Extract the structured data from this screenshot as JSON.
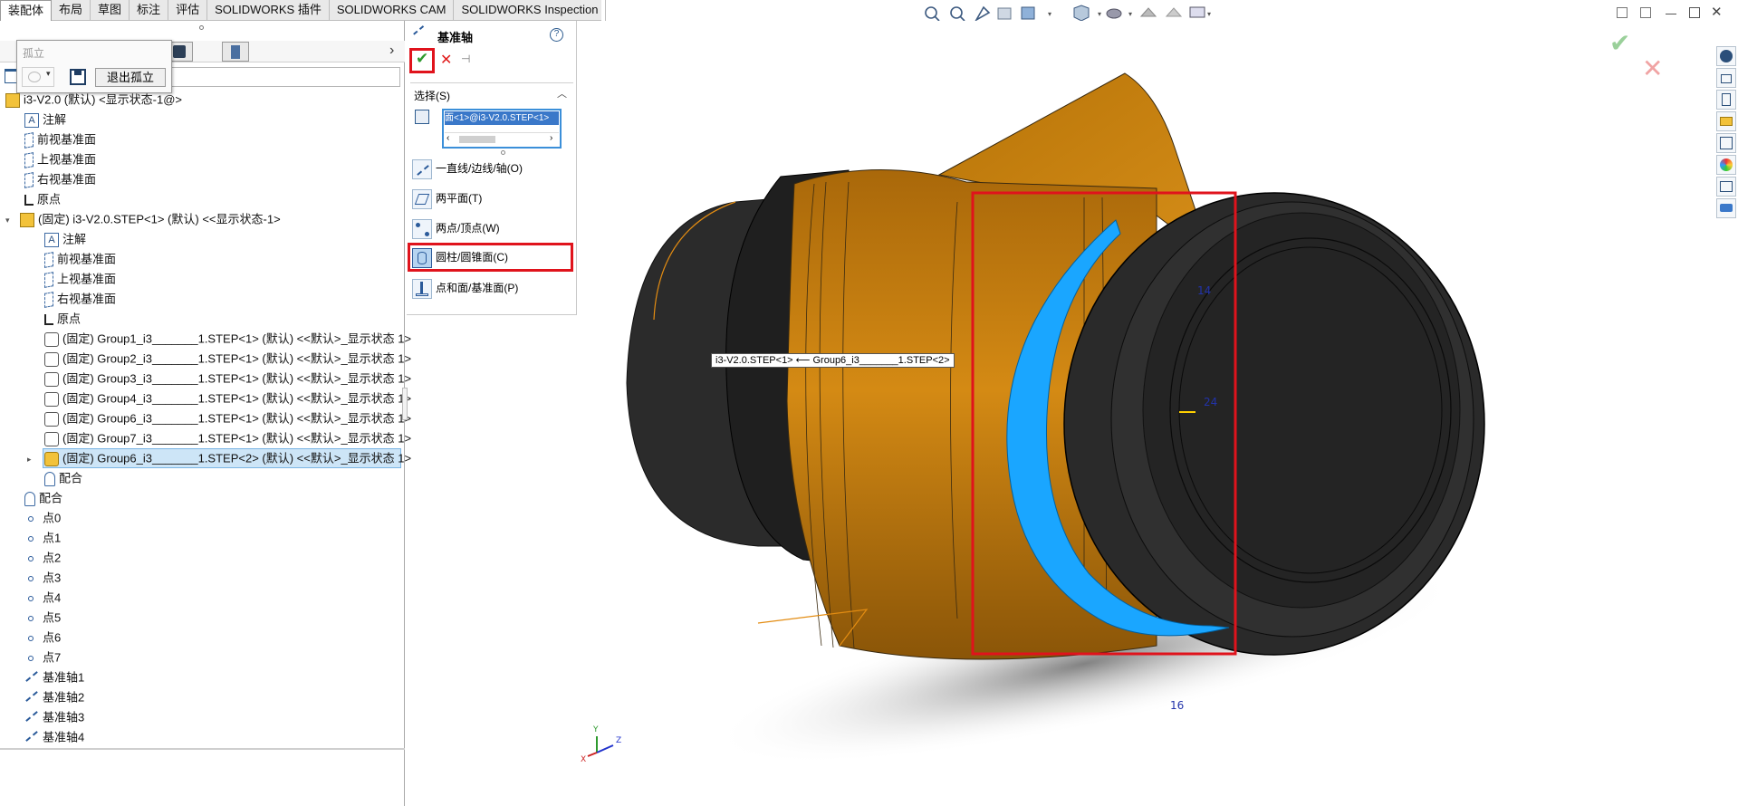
{
  "tabs": [
    "装配体",
    "布局",
    "草图",
    "标注",
    "评估",
    "SOLIDWORKS 插件",
    "SOLIDWORKS CAM",
    "SOLIDWORKS Inspection"
  ],
  "isolate": {
    "title": "孤立",
    "exit_label": "退出孤立"
  },
  "tree": {
    "root_label": "i3-V2.0 (默认) <显示状态-1@>",
    "items": [
      {
        "label": "注解",
        "icon": "annotation-icon"
      },
      {
        "label": "前视基准面",
        "icon": "plane-icon"
      },
      {
        "label": "上视基准面",
        "icon": "plane-icon"
      },
      {
        "label": "右视基准面",
        "icon": "plane-icon"
      },
      {
        "label": "原点",
        "icon": "origin-icon"
      },
      {
        "label": "(固定) i3-V2.0.STEP<1> (默认) <<显示状态-1>",
        "icon": "assembly-icon"
      },
      {
        "label": "注解",
        "icon": "annotation-icon"
      },
      {
        "label": "前视基准面",
        "icon": "plane-icon"
      },
      {
        "label": "上视基准面",
        "icon": "plane-icon"
      },
      {
        "label": "右视基准面",
        "icon": "plane-icon"
      },
      {
        "label": "原点",
        "icon": "origin-icon"
      },
      {
        "label": "(固定) Group1_i3_______1.STEP<1> (默认) <<默认>_显示状态 1>",
        "icon": "part-icon"
      },
      {
        "label": "(固定) Group2_i3_______1.STEP<1> (默认) <<默认>_显示状态 1>",
        "icon": "part-icon"
      },
      {
        "label": "(固定) Group3_i3_______1.STEP<1> (默认) <<默认>_显示状态 1>",
        "icon": "part-icon"
      },
      {
        "label": "(固定) Group4_i3_______1.STEP<1> (默认) <<默认>_显示状态 1>",
        "icon": "part-icon"
      },
      {
        "label": "(固定) Group6_i3_______1.STEP<1> (默认) <<默认>_显示状态 1>",
        "icon": "part-icon"
      },
      {
        "label": "(固定) Group7_i3_______1.STEP<1> (默认) <<默认>_显示状态 1>",
        "icon": "part-icon"
      },
      {
        "label": "(固定) Group6_i3_______1.STEP<2> (默认) <<默认>_显示状态 1>",
        "icon": "part-icon"
      },
      {
        "label": "配合",
        "icon": "mate-icon"
      },
      {
        "label": "配合",
        "icon": "mate-icon"
      },
      {
        "label": "点0",
        "icon": "point-icon"
      },
      {
        "label": "点1",
        "icon": "point-icon"
      },
      {
        "label": "点2",
        "icon": "point-icon"
      },
      {
        "label": "点3",
        "icon": "point-icon"
      },
      {
        "label": "点4",
        "icon": "point-icon"
      },
      {
        "label": "点5",
        "icon": "point-icon"
      },
      {
        "label": "点6",
        "icon": "point-icon"
      },
      {
        "label": "点7",
        "icon": "point-icon"
      },
      {
        "label": "基准轴1",
        "icon": "axis-icon"
      },
      {
        "label": "基准轴2",
        "icon": "axis-icon"
      },
      {
        "label": "基准轴3",
        "icon": "axis-icon"
      },
      {
        "label": "基准轴4",
        "icon": "axis-icon"
      }
    ]
  },
  "property_manager": {
    "title": "基准轴",
    "selection_header": "选择(S)",
    "selection_value": "面<1>@i3-V2.0.STEP<1>",
    "options": [
      {
        "label": "一直线/边线/轴(O)",
        "icon": "line-edge-axis-icon"
      },
      {
        "label": "两平面(T)",
        "icon": "two-planes-icon"
      },
      {
        "label": "两点/顶点(W)",
        "icon": "two-points-icon"
      },
      {
        "label": "圆柱/圆锥面(C)",
        "icon": "cylinder-cone-icon"
      },
      {
        "label": "点和面/基准面(P)",
        "icon": "point-face-icon"
      }
    ]
  },
  "viewport": {
    "tooltip": "i3-V2.0.STEP<1> ⟵ Group6_i3_______1.STEP<2>",
    "triad": {
      "x": "X",
      "y": "Y",
      "z": "Z"
    },
    "markers": [
      "14",
      "24",
      "16"
    ]
  },
  "colors": {
    "accent_red": "#e0131c",
    "body_orange": "#c97e0c",
    "cap_dark": "#2b2b2b",
    "highlight_blue": "#1aa6ff",
    "tab_bg": "#e9e9e9"
  }
}
